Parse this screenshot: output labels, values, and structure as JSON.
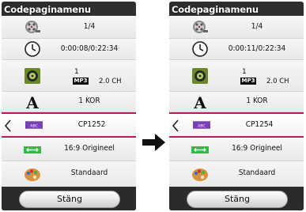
{
  "left": {
    "title": "Codepaginamenu",
    "title_value": "1/4",
    "time": "0:00:08/0:22:34",
    "audio_track": "1",
    "audio_format": "MP3",
    "audio_channels": "2.0 CH",
    "subtitle_lang": "1 KOR",
    "codepage": "CP1252",
    "aspect": "16:9 Origineel",
    "picture_mode": "Standaard",
    "close_label": "Stäng"
  },
  "right": {
    "title": "Codepaginamenu",
    "title_value": "1/4",
    "time": "0:00:11/0:22:34",
    "audio_track": "1",
    "audio_format": "MP3",
    "audio_channels": "2.0 CH",
    "subtitle_lang": "1 KOR",
    "codepage": "CP1254",
    "aspect": "16:9 Origineel",
    "picture_mode": "Standaard",
    "close_label": "Stäng"
  },
  "codepage_badge": "ABC",
  "icons": [
    "film-reel-icon",
    "clock-icon",
    "speaker-icon",
    "letter-a-icon",
    "codepage-icon",
    "aspect-ratio-icon",
    "palette-icon",
    "arrow-right-icon"
  ],
  "colors": {
    "selection_border": "#c2185b",
    "badge": "#7b3fb5",
    "aspect": "#3ab54a"
  }
}
